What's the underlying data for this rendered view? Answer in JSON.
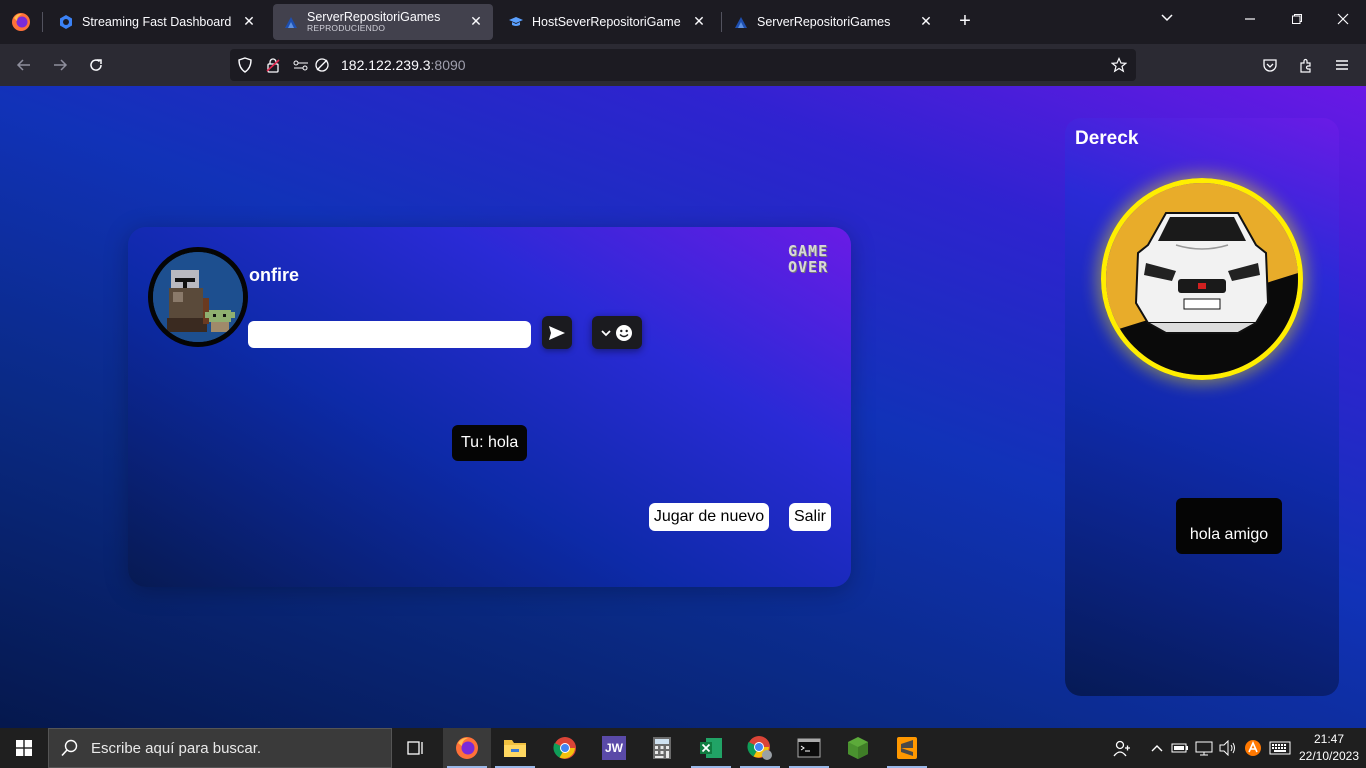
{
  "browser": {
    "tabs": [
      {
        "title": "Streaming Fast Dashboard",
        "subtitle": ""
      },
      {
        "title": "ServerRepositoriGames",
        "subtitle": "REPRODUCIENDO"
      },
      {
        "title": "HostSeverRepositoriGame",
        "subtitle": ""
      },
      {
        "title": "ServerRepositoriGames",
        "subtitle": ""
      }
    ],
    "url_host": "182.122.239.3",
    "url_port": ":8090"
  },
  "game": {
    "player_name": "onfire",
    "chat_value": "",
    "gameover_line1": "GAME",
    "gameover_line2": "OVER",
    "my_message": "Tu: hola",
    "play_again_label": "Jugar de nuevo",
    "exit_label": "Salir"
  },
  "opponent": {
    "name": "Dereck",
    "message": "hola amigo"
  },
  "taskbar": {
    "search_placeholder": "Escribe aquí para buscar.",
    "time": "21:47",
    "date": "22/10/2023",
    "apps": [
      "task-view-icon",
      "firefox-icon",
      "file-explorer-icon",
      "chrome-icon",
      "jw-icon",
      "calculator-icon",
      "excel-icon",
      "chrome-profile-icon",
      "terminal-icon",
      "minecraft-icon",
      "sublime-icon"
    ]
  },
  "colors": {
    "accent_yellow": "#ffee00",
    "page_purple": "#6a18e6",
    "page_blue": "#1132b8"
  }
}
